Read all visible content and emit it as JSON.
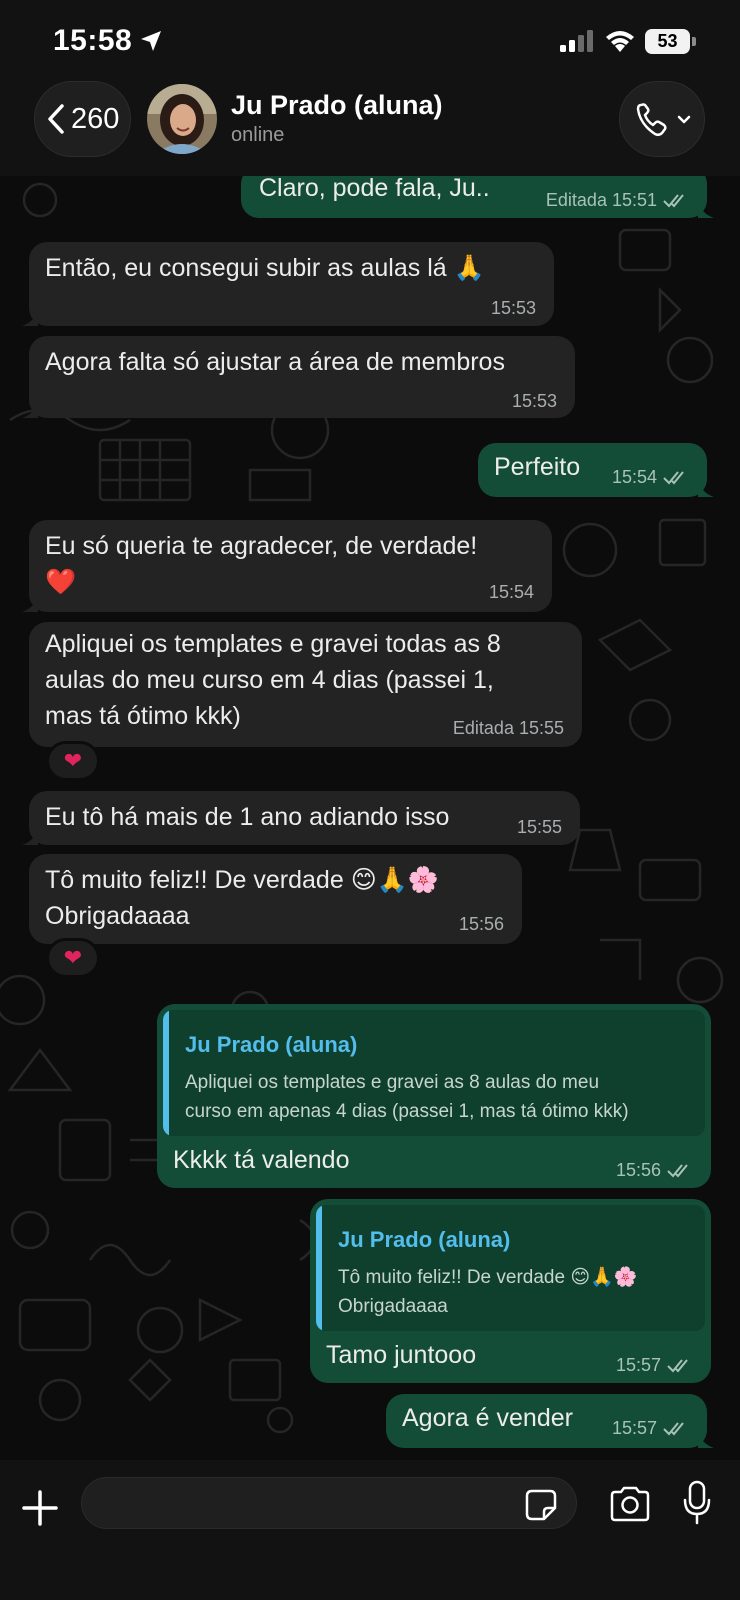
{
  "status_bar": {
    "time": "15:58",
    "battery": "53"
  },
  "header": {
    "back_count": "260",
    "contact_name": "Ju Prado (aluna)",
    "contact_status": "online"
  },
  "messages": [
    {
      "dir": "out",
      "text": "Claro, pode fala, Ju..",
      "meta": "Editada 15:51"
    },
    {
      "dir": "in",
      "text": "Então, eu consegui subir as aulas lá 🙏",
      "meta": "15:53"
    },
    {
      "dir": "in",
      "text": "Agora falta só ajustar a área de membros",
      "meta": "15:53"
    },
    {
      "dir": "out",
      "text": "Perfeito",
      "meta": "15:54"
    },
    {
      "dir": "in",
      "text": "Eu só queria te agradecer, de verdade!\n❤️",
      "meta": "15:54"
    },
    {
      "dir": "in",
      "text": "Apliquei os templates e gravei todas as 8\naulas do meu curso em 4 dias (passei 1,\nmas tá ótimo kkk)",
      "meta": "Editada 15:55",
      "reaction": "❤"
    },
    {
      "dir": "in",
      "text": "Eu tô há mais de 1 ano adiando isso",
      "meta": "15:55"
    },
    {
      "dir": "in",
      "text": "Tô muito feliz!! De verdade 😊🙏🌸\nObrigadaaaa",
      "meta": "15:56",
      "reaction": "❤"
    },
    {
      "dir": "out",
      "text": "Kkkk tá valendo",
      "meta": "15:56",
      "quote": {
        "author": "Ju Prado (aluna)",
        "text": "Apliquei os templates e gravei as 8 aulas do meu\ncurso em apenas 4 dias (passei 1, mas tá ótimo kkk)"
      }
    },
    {
      "dir": "out",
      "text": "Tamo juntooo",
      "meta": "15:57",
      "quote": {
        "author": "Ju Prado (aluna)",
        "text": "Tô muito feliz!! De verdade 😊🙏🌸\nObrigadaaaa"
      }
    },
    {
      "dir": "out",
      "text": "Agora é vender",
      "meta": "15:57"
    }
  ],
  "composer": {
    "value": "",
    "placeholder": ""
  },
  "colors": {
    "incoming": "#232323",
    "outgoing": "#144d37",
    "quote_accent": "#53bdeb",
    "background": "#0c0c0c"
  },
  "icons": [
    "location-arrow-icon",
    "signal-icon",
    "wifi-icon",
    "battery-icon",
    "chevron-left-icon",
    "phone-icon",
    "chevron-down-icon",
    "double-check-icon",
    "heart-icon",
    "plus-icon",
    "sticker-icon",
    "camera-icon",
    "microphone-icon"
  ]
}
